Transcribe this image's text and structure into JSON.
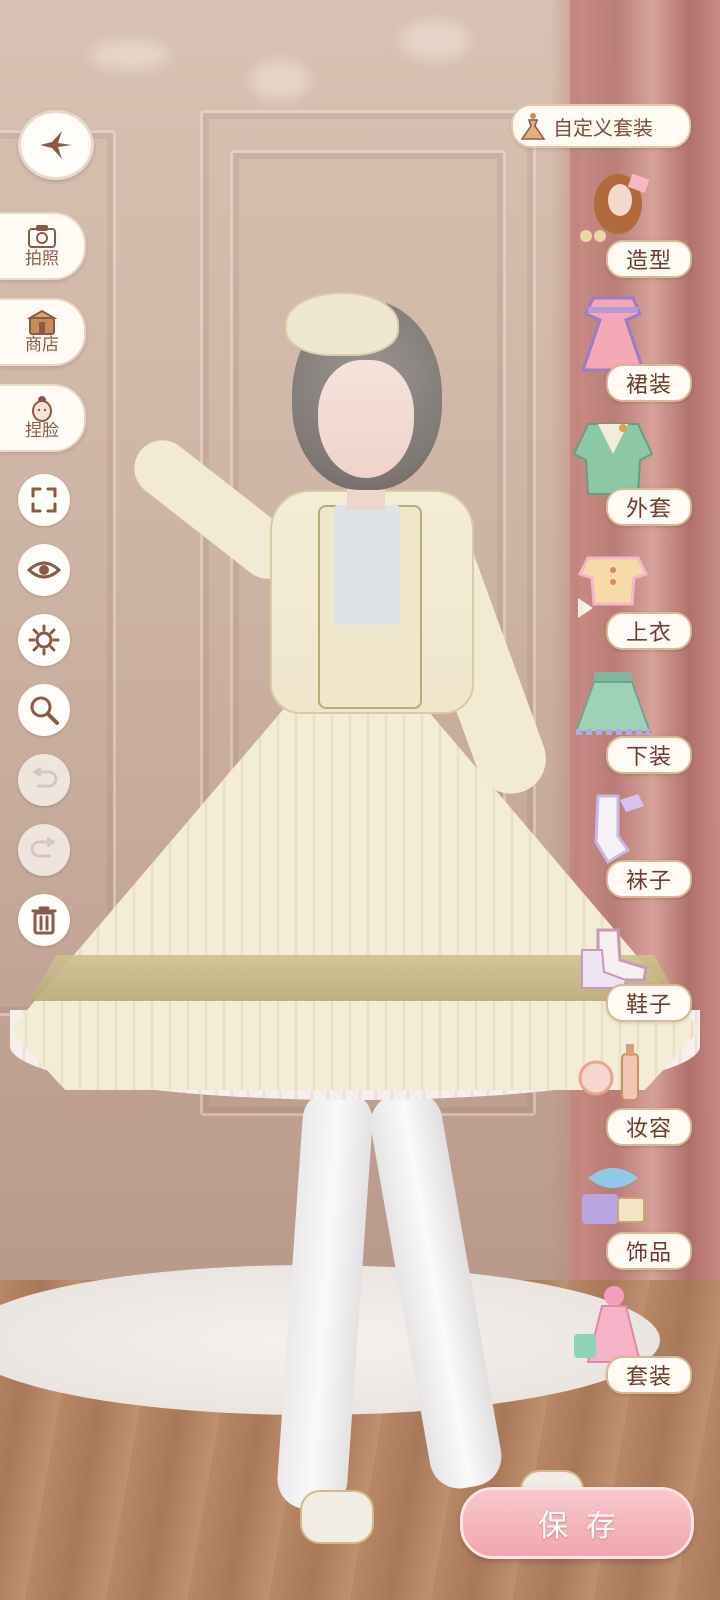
{
  "toolbar": {
    "back_icon": "sparkle-back-icon",
    "buttons": [
      {
        "label": "拍照",
        "icon": "camera-icon"
      },
      {
        "label": "商店",
        "icon": "shop-icon"
      },
      {
        "label": "捏脸",
        "icon": "face-edit-icon"
      }
    ],
    "tools": [
      {
        "icon": "fullscreen-icon",
        "enabled": true
      },
      {
        "icon": "eye-icon",
        "enabled": true
      },
      {
        "icon": "lighting-icon",
        "enabled": true
      },
      {
        "icon": "zoom-icon",
        "enabled": true
      },
      {
        "icon": "undo-icon",
        "enabled": false
      },
      {
        "icon": "redo-icon",
        "enabled": false
      },
      {
        "icon": "trash-icon",
        "enabled": true
      }
    ]
  },
  "custom_outfit": {
    "label": "自定义套装",
    "icon": "dress-icon"
  },
  "categories": [
    {
      "label": "造型",
      "icon": "hairstyle-icon"
    },
    {
      "label": "裙装",
      "icon": "dress-icon"
    },
    {
      "label": "外套",
      "icon": "coat-icon"
    },
    {
      "label": "上衣",
      "icon": "top-icon"
    },
    {
      "label": "下装",
      "icon": "skirt-icon"
    },
    {
      "label": "袜子",
      "icon": "socks-icon"
    },
    {
      "label": "鞋子",
      "icon": "shoes-icon"
    },
    {
      "label": "妆容",
      "icon": "makeup-icon"
    },
    {
      "label": "饰品",
      "icon": "accessory-icon"
    },
    {
      "label": "套装",
      "icon": "outfit-set-icon"
    }
  ],
  "save_label": "保存",
  "colors": {
    "accent_brown": "#8a5c48",
    "save_pink": "#f0a7ad",
    "pill_border": "#d9b893"
  }
}
